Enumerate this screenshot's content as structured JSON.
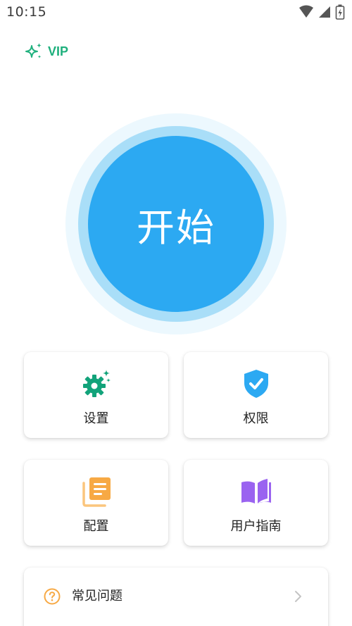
{
  "status_bar": {
    "time": "10:15",
    "icons": [
      "wifi-icon",
      "signal-icon",
      "battery-icon"
    ]
  },
  "vip": {
    "label": "VIP",
    "icon": "sparkle-icon",
    "color": "#1fb07d"
  },
  "start": {
    "label": "开始",
    "color": "#2ca9f2"
  },
  "grid": [
    {
      "label": "设置",
      "icon": "gear-icon",
      "color": "#12a37a"
    },
    {
      "label": "权限",
      "icon": "shield-check-icon",
      "color": "#2ca9f2"
    },
    {
      "label": "配置",
      "icon": "document-stack-icon",
      "color": "#f7a944"
    },
    {
      "label": "用户指南",
      "icon": "book-icon",
      "color": "#9a63f0"
    }
  ],
  "faq": {
    "label": "常见问题",
    "icon": "question-circle-icon",
    "chevron": "chevron-right-icon",
    "icon_color": "#f7a944"
  }
}
